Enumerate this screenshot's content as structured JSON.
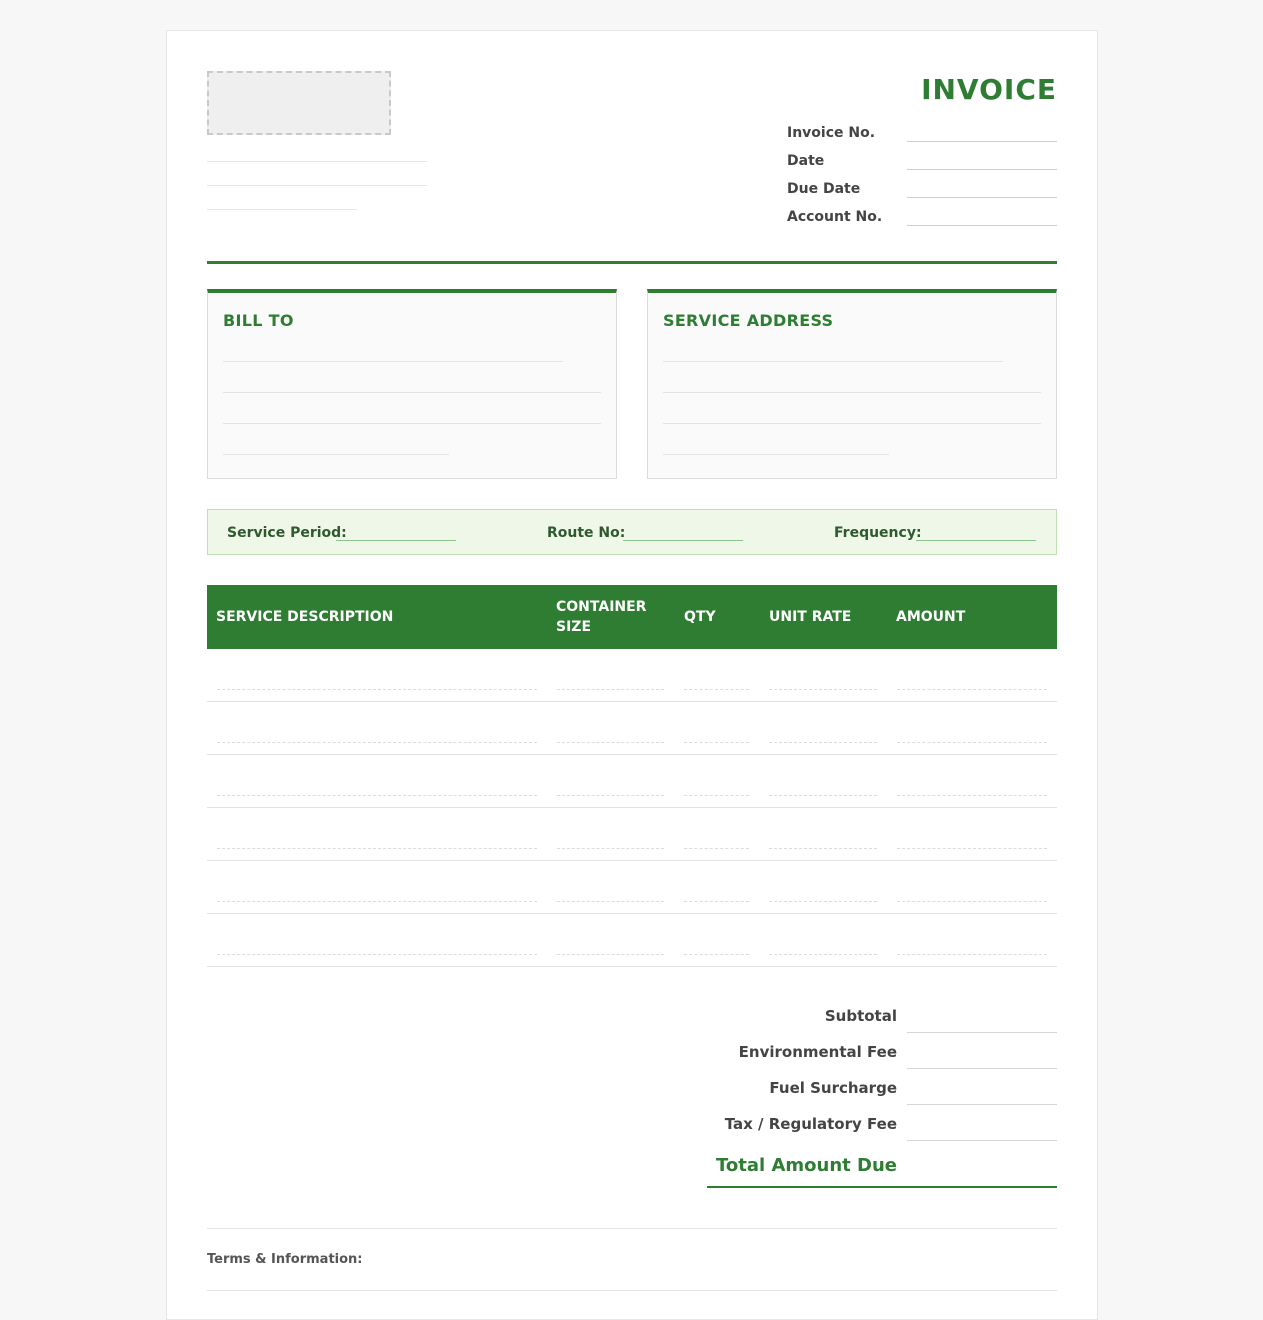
{
  "header": {
    "title": "INVOICE",
    "fields": [
      {
        "label": "Invoice No.",
        "value": ""
      },
      {
        "label": "Date",
        "value": ""
      },
      {
        "label": "Due Date",
        "value": ""
      },
      {
        "label": "Account No.",
        "value": ""
      }
    ]
  },
  "bill_to": {
    "title": "BILL TO"
  },
  "service_address": {
    "title": "SERVICE ADDRESS"
  },
  "service_info": {
    "service_period_label": "Service Period:",
    "route_no_label": "Route No:",
    "frequency_label": "Frequency:"
  },
  "table": {
    "columns": [
      "SERVICE DESCRIPTION",
      "CONTAINER SIZE",
      "QTY",
      "UNIT RATE",
      "AMOUNT"
    ],
    "rows": [
      [
        "",
        "",
        "",
        "",
        ""
      ],
      [
        "",
        "",
        "",
        "",
        ""
      ],
      [
        "",
        "",
        "",
        "",
        ""
      ],
      [
        "",
        "",
        "",
        "",
        ""
      ],
      [
        "",
        "",
        "",
        "",
        ""
      ],
      [
        "",
        "",
        "",
        "",
        ""
      ]
    ]
  },
  "totals": {
    "subtotal_label": "Subtotal",
    "environmental_fee_label": "Environmental Fee",
    "fuel_surcharge_label": "Fuel Surcharge",
    "tax_label": "Tax / Regulatory Fee",
    "total_due_label": "Total Amount Due"
  },
  "footer": {
    "terms_label": "Terms & Information:"
  },
  "colors": {
    "accent": "#2e7d32",
    "band_bg": "#eff7e8"
  }
}
